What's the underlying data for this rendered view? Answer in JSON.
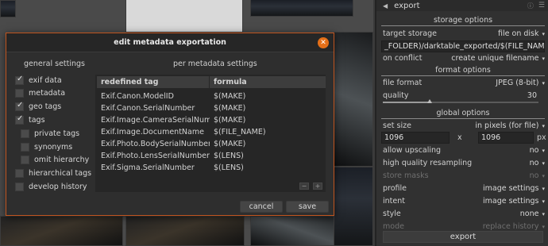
{
  "panel": {
    "header_title": "export",
    "storage_options_title": "storage options",
    "target_storage_label": "target storage",
    "target_storage_value": "file on disk",
    "path_value": "_FOLDER)/darktable_exported/$(FILE_NAME)",
    "on_conflict_label": "on conflict",
    "on_conflict_value": "create unique filename",
    "format_options_title": "format options",
    "file_format_label": "file format",
    "file_format_value": "JPEG (8-bit)",
    "quality_label": "quality",
    "quality_value": "30",
    "quality_fraction": 0.3,
    "global_options_title": "global options",
    "set_size_label": "set size",
    "set_size_value": "in pixels (for file)",
    "width_value": "1096",
    "x_label": "x",
    "height_value": "1096",
    "px_label": "px",
    "allow_upscaling_label": "allow upscaling",
    "allow_upscaling_value": "no",
    "hq_resampling_label": "high quality resampling",
    "hq_resampling_value": "no",
    "store_masks_label": "store masks",
    "store_masks_value": "no",
    "profile_label": "profile",
    "profile_value": "image settings",
    "intent_label": "intent",
    "intent_value": "image settings",
    "style_label": "style",
    "style_value": "none",
    "mode_label": "mode",
    "mode_value": "replace history",
    "export_button": "export"
  },
  "dialog": {
    "title": "edit metadata exportation",
    "general_settings_title": "general settings",
    "per_metadata_title": "per metadata settings",
    "options": [
      {
        "label": "exif data",
        "checked": true
      },
      {
        "label": "metadata",
        "checked": false
      },
      {
        "label": "geo tags",
        "checked": true
      },
      {
        "label": "tags",
        "checked": true
      },
      {
        "label": "private tags",
        "checked": false
      },
      {
        "label": "synonyms",
        "checked": false
      },
      {
        "label": "omit hierarchy",
        "checked": false
      },
      {
        "label": "hierarchical tags",
        "checked": false
      },
      {
        "label": "develop history",
        "checked": false
      }
    ],
    "table": {
      "headers": [
        "redefined tag",
        "formula"
      ],
      "rows": [
        [
          "Exif.Canon.ModelID",
          "$(MAKE)"
        ],
        [
          "Exif.Canon.SerialNumber",
          "$(MAKE)"
        ],
        [
          "Exif.Image.CameraSerialNumber",
          "$(MAKE)"
        ],
        [
          "Exif.Image.DocumentName",
          "$(FILE_NAME)"
        ],
        [
          "Exif.Photo.BodySerialNumber",
          "$(MAKE)"
        ],
        [
          "Exif.Photo.LensSerialNumber",
          "$(LENS)"
        ],
        [
          "Exif.Sigma.SerialNumber",
          "$(LENS)"
        ]
      ]
    },
    "remove_label": "−",
    "add_label": "+",
    "cancel_label": "cancel",
    "save_label": "save"
  },
  "colors": {
    "accent": "#e46f18",
    "dialog_border": "#c1551f"
  }
}
